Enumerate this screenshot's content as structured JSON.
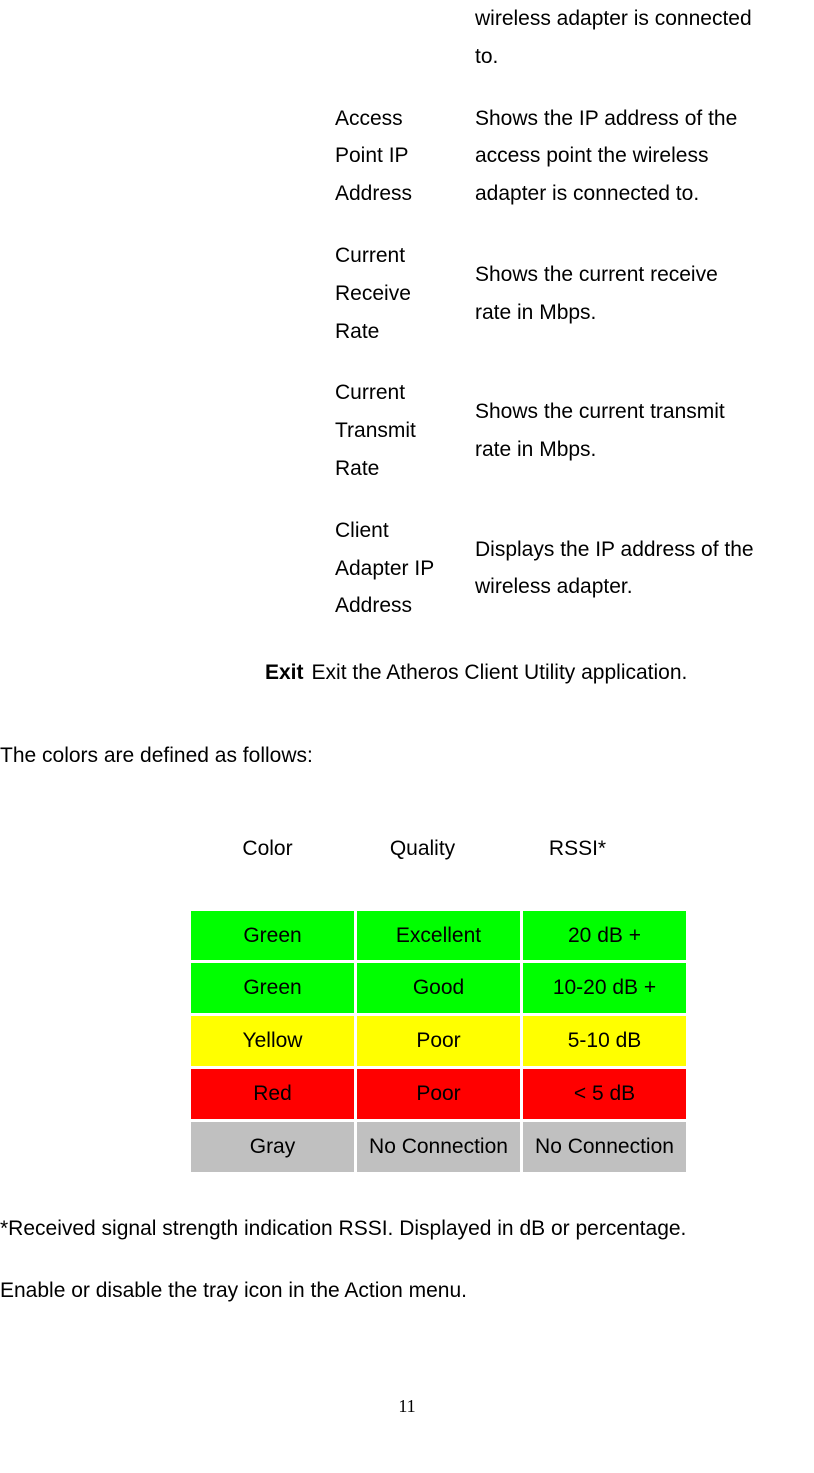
{
  "definitions": {
    "partial": {
      "desc": "wireless adapter is connected to."
    },
    "ap_ip": {
      "label": "Access Point IP Address",
      "desc": "Shows the IP address of the access point the wireless adapter is connected to."
    },
    "rx_rate": {
      "label": "Current Receive Rate",
      "desc": "Shows the current receive rate in Mbps."
    },
    "tx_rate": {
      "label": "Current Transmit Rate",
      "desc": "Shows the current transmit rate in Mbps."
    },
    "client_ip": {
      "label": "Client Adapter IP Address",
      "desc": "Displays the IP address of the wireless adapter."
    }
  },
  "exit": {
    "label": "Exit",
    "desc": "Exit the Atheros Client Utility application."
  },
  "colors_intro": "The colors are defined as follows:",
  "color_table": {
    "headers": {
      "color": "Color",
      "quality": "Quality",
      "rssi": "RSSI*"
    }
  },
  "chart_data": {
    "type": "table",
    "columns": [
      "Color",
      "Quality",
      "RSSI*"
    ],
    "rows": [
      {
        "color": "Green",
        "quality": "Excellent",
        "rssi": "20 dB +",
        "bg": "green"
      },
      {
        "color": "Green",
        "quality": "Good",
        "rssi": "10-20 dB +",
        "bg": "green"
      },
      {
        "color": "Yellow",
        "quality": "Poor",
        "rssi": "5-10 dB",
        "bg": "yellow"
      },
      {
        "color": "Red",
        "quality": "Poor",
        "rssi": "< 5 dB",
        "bg": "red"
      },
      {
        "color": "Gray",
        "quality": "No Connection",
        "rssi": "No Connection",
        "bg": "gray"
      }
    ]
  },
  "footnote": "*Received signal strength indication RSSI. Displayed in dB or percentage.",
  "action_note": "Enable or disable the tray icon in the Action menu.",
  "page_number": "11"
}
